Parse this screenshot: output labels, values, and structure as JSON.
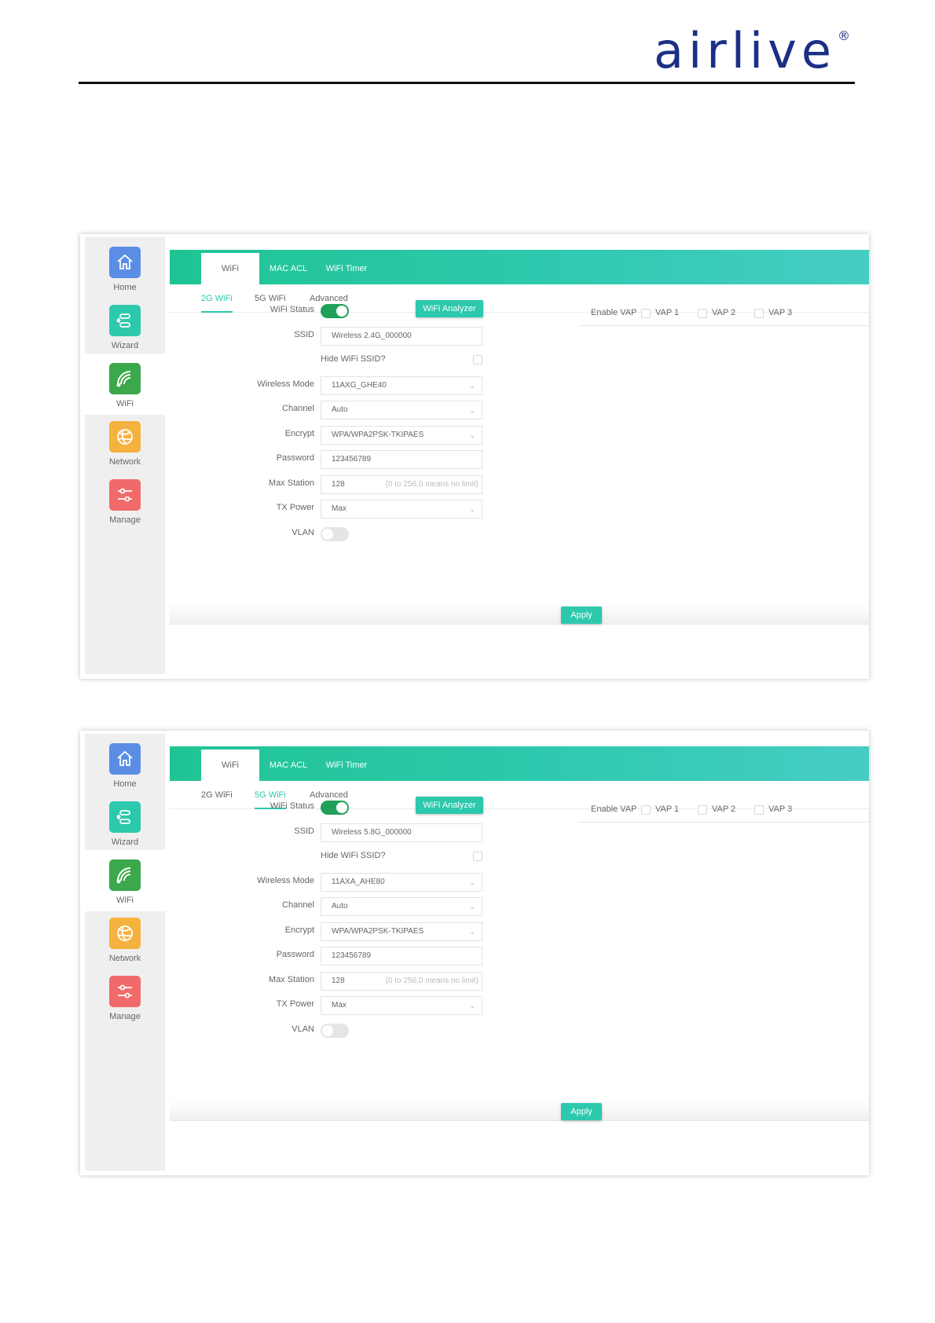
{
  "logo": {
    "text": "airlive",
    "reg": "®"
  },
  "panels": [
    {
      "sidebar": [
        {
          "label": "Home",
          "icon": "home-icon",
          "color": "#5b8de5"
        },
        {
          "label": "Wizard",
          "icon": "wizard-icon",
          "color": "#2cc9ad"
        },
        {
          "label": "WiFi",
          "icon": "wifi-icon",
          "color": "#3aa84b"
        },
        {
          "label": "Network",
          "icon": "globe-icon",
          "color": "#f6b23e"
        },
        {
          "label": "Manage",
          "icon": "sliders-icon",
          "color": "#f16a6a"
        }
      ],
      "tabs": [
        "WiFi",
        "MAC ACL",
        "WiFi Timer"
      ],
      "subtabs": [
        "2G WiFi",
        "5G WiFi",
        "Advanced"
      ],
      "active_subtab": "2G WiFi",
      "form": {
        "wifi_status_label": "WiFi Status",
        "analyzer_button": "WiFi Analyzer",
        "ssid_label": "SSID",
        "ssid_value": "Wireless 2.4G_000000",
        "hide_ssid_label": "Hide WiFi SSID?",
        "mode_label": "Wireless Mode",
        "mode_value": "11AXG_GHE40",
        "channel_label": "Channel",
        "channel_value": "Auto",
        "encrypt_label": "Encrypt",
        "encrypt_value": "WPA/WPA2PSK-TKIPAES",
        "password_label": "Password",
        "password_value": "123456789",
        "max_station_label": "Max Station",
        "max_station_value": "128",
        "max_station_hint": "(0 to 256,0 means no limit)",
        "tx_power_label": "TX Power",
        "tx_power_value": "Max",
        "vlan_label": "VLAN"
      },
      "vap": {
        "enable_label": "Enable VAP",
        "items": [
          "VAP 1",
          "VAP 2",
          "VAP 3"
        ]
      },
      "apply_button": "Apply"
    },
    {
      "sidebar": [
        {
          "label": "Home",
          "icon": "home-icon",
          "color": "#5b8de5"
        },
        {
          "label": "Wizard",
          "icon": "wizard-icon",
          "color": "#2cc9ad"
        },
        {
          "label": "WiFi",
          "icon": "wifi-icon",
          "color": "#3aa84b"
        },
        {
          "label": "Network",
          "icon": "globe-icon",
          "color": "#f6b23e"
        },
        {
          "label": "Manage",
          "icon": "sliders-icon",
          "color": "#f16a6a"
        }
      ],
      "tabs": [
        "WiFi",
        "MAC ACL",
        "WiFi Timer"
      ],
      "subtabs": [
        "2G WiFi",
        "5G WiFi",
        "Advanced"
      ],
      "active_subtab": "5G WiFi",
      "form": {
        "wifi_status_label": "WiFi Status",
        "analyzer_button": "WiFi Analyzer",
        "ssid_label": "SSID",
        "ssid_value": "Wireless 5.8G_000000",
        "hide_ssid_label": "Hide WiFi SSID?",
        "mode_label": "Wireless Mode",
        "mode_value": "11AXA_AHE80",
        "channel_label": "Channel",
        "channel_value": "Auto",
        "encrypt_label": "Encrypt",
        "encrypt_value": "WPA/WPA2PSK-TKIPAES",
        "password_label": "Password",
        "password_value": "123456789",
        "max_station_label": "Max Station",
        "max_station_value": "128",
        "max_station_hint": "(0 to 256,0 means no limit)",
        "tx_power_label": "TX Power",
        "tx_power_value": "Max",
        "vlan_label": "VLAN"
      },
      "vap": {
        "enable_label": "Enable VAP",
        "items": [
          "VAP 1",
          "VAP 2",
          "VAP 3"
        ]
      },
      "apply_button": "Apply"
    }
  ]
}
